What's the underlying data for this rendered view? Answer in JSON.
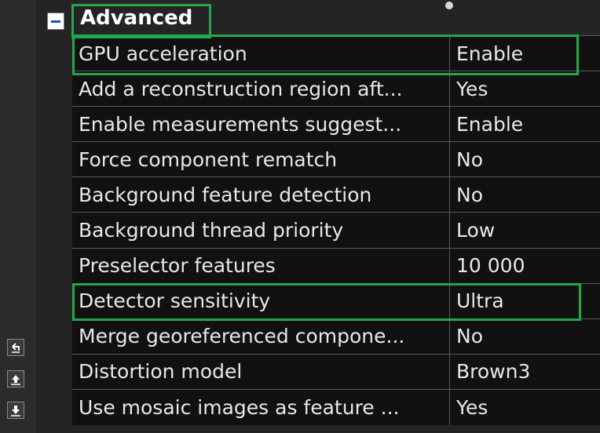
{
  "section": {
    "title": "Advanced",
    "collapse_symbol": "minus"
  },
  "properties": [
    {
      "name": "GPU acceleration",
      "value": "Enable",
      "highlighted": true
    },
    {
      "name": "Add a reconstruction region aft...",
      "value": "Yes",
      "highlighted": false
    },
    {
      "name": "Enable measurements suggest...",
      "value": "Enable",
      "highlighted": false
    },
    {
      "name": "Force component rematch",
      "value": "No",
      "highlighted": false
    },
    {
      "name": "Background feature detection",
      "value": "No",
      "highlighted": false
    },
    {
      "name": "Background thread priority",
      "value": "Low",
      "highlighted": false
    },
    {
      "name": "Preselector features",
      "value": "10 000",
      "highlighted": false
    },
    {
      "name": "Detector sensitivity",
      "value": "Ultra",
      "highlighted": true
    },
    {
      "name": "Merge georeferenced compone...",
      "value": "No",
      "highlighted": false
    },
    {
      "name": "Distortion model",
      "value": "Brown3",
      "highlighted": false
    },
    {
      "name": "Use mosaic images as feature ...",
      "value": "Yes",
      "highlighted": false
    }
  ],
  "side_toolbar": [
    {
      "icon": "undo-arrow-icon"
    },
    {
      "icon": "upload-arrow-icon"
    },
    {
      "icon": "download-arrow-icon"
    }
  ],
  "colors": {
    "highlight": "#22a84a",
    "grid_line": "#5a5a5a",
    "cell_background": "#111111",
    "collapse_icon": "#1f4fbf"
  }
}
